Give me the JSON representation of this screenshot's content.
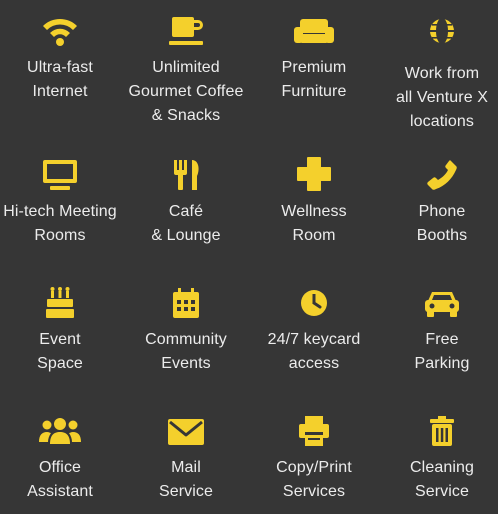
{
  "colors": {
    "background": "#363636",
    "icon": "#f4d02c",
    "text": "#ececec"
  },
  "amenities": [
    {
      "icon": "wifi-icon",
      "label": "Ultra-fast\nInternet"
    },
    {
      "icon": "coffee-cup-icon",
      "label": "Unlimited\nGourmet Coffee\n& Snacks"
    },
    {
      "icon": "sofa-icon",
      "label": "Premium\nFurniture"
    },
    {
      "icon": "globe-icon",
      "label": "Work from\nall Venture X\nlocations"
    },
    {
      "icon": "monitor-icon",
      "label": "Hi-tech Meeting\nRooms"
    },
    {
      "icon": "fork-knife-icon",
      "label": "Café\n& Lounge"
    },
    {
      "icon": "medical-cross-icon",
      "label": "Wellness\nRoom"
    },
    {
      "icon": "phone-icon",
      "label": "Phone\nBooths"
    },
    {
      "icon": "birthday-cake-icon",
      "label": "Event\nSpace"
    },
    {
      "icon": "calendar-icon",
      "label": "Community\nEvents"
    },
    {
      "icon": "clock-icon",
      "label": "24/7 keycard\naccess"
    },
    {
      "icon": "car-icon",
      "label": "Free\nParking"
    },
    {
      "icon": "users-icon",
      "label": "Office\nAssistant"
    },
    {
      "icon": "envelope-icon",
      "label": "Mail\nService"
    },
    {
      "icon": "printer-icon",
      "label": "Copy/Print\nServices"
    },
    {
      "icon": "trash-icon",
      "label": "Cleaning\nService"
    }
  ]
}
